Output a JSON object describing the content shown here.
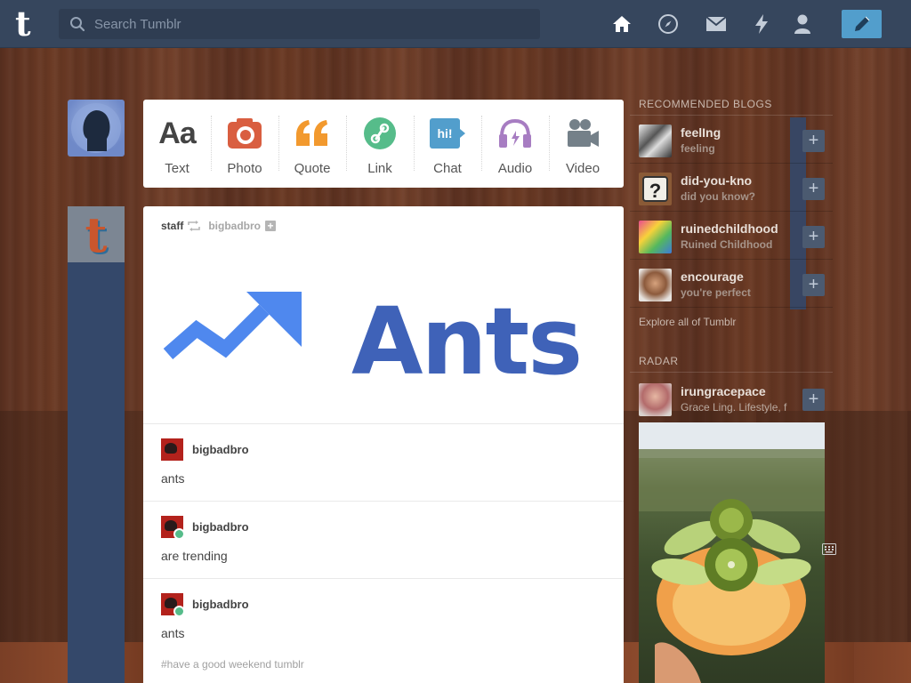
{
  "app": {
    "logo_text": "t"
  },
  "search": {
    "placeholder": "Search Tumblr",
    "value": ""
  },
  "nav": {
    "icons": [
      "home-icon",
      "compass-icon",
      "mail-icon",
      "lightning-icon",
      "account-icon"
    ],
    "compose_icon": "pencil-icon",
    "colors": {
      "bar": "#36465d",
      "compose": "#529ecc"
    }
  },
  "post_types": [
    {
      "label": "Text",
      "icon": "text-icon",
      "color": "#444444"
    },
    {
      "label": "Photo",
      "icon": "camera-icon",
      "color": "#d95e40"
    },
    {
      "label": "Quote",
      "icon": "quote-icon",
      "color": "#f2992e"
    },
    {
      "label": "Link",
      "icon": "link-icon",
      "color": "#56bc8a"
    },
    {
      "label": "Chat",
      "icon": "chat-icon",
      "color": "#529ecc"
    },
    {
      "label": "Audio",
      "icon": "headphones-icon",
      "color": "#a77dc2"
    },
    {
      "label": "Video",
      "icon": "video-camera-icon",
      "color": "#748089"
    }
  ],
  "post": {
    "author": "staff",
    "reblogged_from": "bigbadbro",
    "image_text": "Ants",
    "entries": [
      {
        "name": "bigbadbro",
        "text": "ants",
        "reblog": false
      },
      {
        "name": "bigbadbro",
        "text": "are trending",
        "reblog": true
      },
      {
        "name": "bigbadbro",
        "text": "ants",
        "reblog": true
      }
    ],
    "tags": "#have a good weekend tumblr"
  },
  "sidebar": {
    "recommended_title": "RECOMMENDED BLOGS",
    "blogs": [
      {
        "name": "feelIng",
        "subtitle": "feeling"
      },
      {
        "name": "did-you-kno",
        "subtitle": "did you know?"
      },
      {
        "name": "ruinedchildhood",
        "subtitle": "Ruined Childhood"
      },
      {
        "name": "encourage",
        "subtitle": "you're perfect"
      }
    ],
    "explore": "Explore all of Tumblr",
    "radar_title": "RADAR",
    "radar_blog": {
      "name": "irungracepace",
      "subtitle": "Grace Ling. Lifestyle, f"
    }
  }
}
